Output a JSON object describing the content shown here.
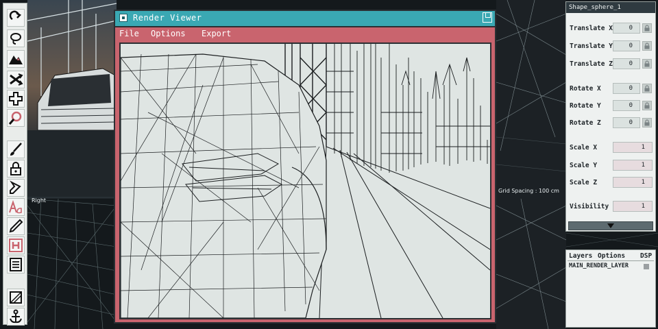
{
  "window": {
    "title": "Render Viewer",
    "menu": [
      "File",
      "Options",
      "Export"
    ]
  },
  "toolbar": {
    "tools": [
      "redo-icon",
      "lasso-icon",
      "mountain-icon",
      "shuffle-icon",
      "add-icon",
      "zoom-icon",
      "brush-icon",
      "lock-icon",
      "pen-icon",
      "text-tool-icon",
      "pencil-icon",
      "h-icon",
      "document-icon",
      "frame-icon",
      "anchor-icon"
    ]
  },
  "viewport": {
    "grid_spacing": "Grid Spacing : 100 cm",
    "view_label": "Right"
  },
  "attributes": {
    "shape_name": "Shape_sphere_1",
    "rows": [
      {
        "label": "Translate X",
        "value": "0",
        "locked": true
      },
      {
        "label": "Translate Y",
        "value": "0",
        "locked": true
      },
      {
        "label": "Translate Z",
        "value": "0",
        "locked": true
      },
      {
        "label": "Rotate X",
        "value": "0",
        "locked": true
      },
      {
        "label": "Rotate Y",
        "value": "0",
        "locked": true
      },
      {
        "label": "Rotate Z",
        "value": "0",
        "locked": true
      },
      {
        "label": "Scale X",
        "value": "1",
        "locked": false
      },
      {
        "label": "Scale Y",
        "value": "1",
        "locked": false
      },
      {
        "label": "Scale Z",
        "value": "1",
        "locked": false
      },
      {
        "label": "Visibility",
        "value": "1",
        "locked": false
      }
    ]
  },
  "layers": {
    "menu": [
      "Layers",
      "Options",
      "DSP"
    ],
    "items": [
      {
        "name": "MAIN_RENDER_LAYER",
        "color": "#9a9fa1"
      }
    ]
  },
  "colors": {
    "title_bar": "#3aa8b3",
    "window_frame": "#c9646e",
    "canvas_bg": "#dfe5e3"
  }
}
